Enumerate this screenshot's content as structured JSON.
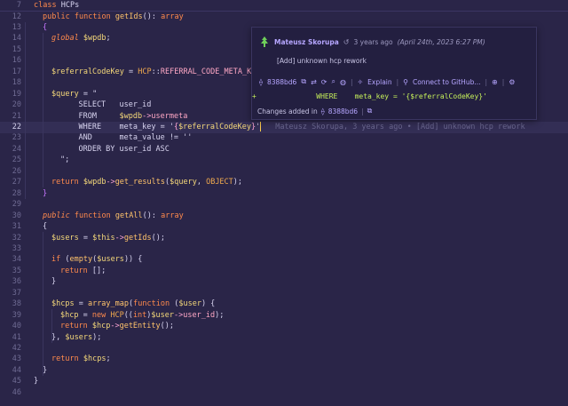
{
  "editor": {
    "sticky": {
      "number": "7",
      "kw": "class",
      "name": "HCPs"
    },
    "ghost_blame": "Mateusz Skorupa, 3 years ago • [Add] unknown hcp rework",
    "lines": [
      {
        "n": "12",
        "segs": [
          [
            "k",
            "public"
          ],
          [
            "c",
            " "
          ],
          [
            "k",
            "function"
          ],
          [
            "c",
            " "
          ],
          [
            "f",
            "getIds"
          ],
          [
            "c",
            "(): "
          ],
          [
            "k",
            "array"
          ]
        ]
      },
      {
        "n": "13",
        "segs": [
          [
            "bl",
            "{"
          ]
        ]
      },
      {
        "n": "14",
        "segs": [
          [
            "ki",
            "global"
          ],
          [
            "c",
            " "
          ],
          [
            "v",
            "$wpdb"
          ],
          [
            "c",
            ";"
          ]
        ]
      },
      {
        "n": "15",
        "segs": []
      },
      {
        "n": "16",
        "segs": []
      },
      {
        "n": "17",
        "segs": [
          [
            "v",
            "$referralCodeKey"
          ],
          [
            "c",
            " = "
          ],
          [
            "cls",
            "HCP"
          ],
          [
            "c",
            "::"
          ],
          [
            "s",
            "REFERRAL_CODE_META_KEY"
          ]
        ]
      },
      {
        "n": "18",
        "segs": []
      },
      {
        "n": "19",
        "segs": [
          [
            "v",
            "$query"
          ],
          [
            "c",
            " = \""
          ]
        ]
      },
      {
        "n": "20",
        "segs": [
          [
            "c",
            "    SELECT   user_id"
          ]
        ]
      },
      {
        "n": "21",
        "segs": [
          [
            "c",
            "    FROM     "
          ],
          [
            "v",
            "$wpdb"
          ],
          [
            "o",
            "->"
          ],
          [
            "s",
            "usermeta"
          ]
        ]
      },
      {
        "n": "22",
        "segs": [
          [
            "c",
            "    WHERE    meta_key = '"
          ],
          [
            "o",
            "{"
          ],
          [
            "v",
            "$referralCodeKey"
          ],
          [
            "o",
            "}"
          ],
          [
            "c",
            "'"
          ]
        ]
      },
      {
        "n": "23",
        "segs": [
          [
            "c",
            "    AND      meta_value != ''"
          ]
        ]
      },
      {
        "n": "24",
        "segs": [
          [
            "c",
            "    ORDER BY user_id ASC"
          ]
        ]
      },
      {
        "n": "25",
        "segs": [
          [
            "c",
            "\";"
          ]
        ]
      },
      {
        "n": "26",
        "segs": []
      },
      {
        "n": "27",
        "segs": [
          [
            "k",
            "return"
          ],
          [
            "c",
            " "
          ],
          [
            "v",
            "$wpdb"
          ],
          [
            "o",
            "->"
          ],
          [
            "f",
            "get_results"
          ],
          [
            "c",
            "("
          ],
          [
            "v",
            "$query"
          ],
          [
            "c",
            ", "
          ],
          [
            "cls",
            "OBJECT"
          ],
          [
            "c",
            ");"
          ]
        ]
      },
      {
        "n": "28",
        "segs": [
          [
            "bl",
            "}"
          ]
        ]
      },
      {
        "n": "29",
        "segs": []
      },
      {
        "n": "30",
        "segs": [
          [
            "ki",
            "public"
          ],
          [
            "c",
            " "
          ],
          [
            "k",
            "function"
          ],
          [
            "c",
            " "
          ],
          [
            "f",
            "getAll"
          ],
          [
            "c",
            "(): "
          ],
          [
            "k",
            "array"
          ]
        ]
      },
      {
        "n": "31",
        "segs": [
          [
            "c",
            "{"
          ]
        ]
      },
      {
        "n": "32",
        "segs": [
          [
            "v",
            "$users"
          ],
          [
            "c",
            " = "
          ],
          [
            "v",
            "$this"
          ],
          [
            "o",
            "->"
          ],
          [
            "f",
            "getIds"
          ],
          [
            "c",
            "();"
          ]
        ]
      },
      {
        "n": "33",
        "segs": []
      },
      {
        "n": "34",
        "segs": [
          [
            "k",
            "if"
          ],
          [
            "c",
            " ("
          ],
          [
            "f",
            "empty"
          ],
          [
            "c",
            "("
          ],
          [
            "v",
            "$users"
          ],
          [
            "c",
            ")) {"
          ]
        ]
      },
      {
        "n": "35",
        "segs": [
          [
            "k",
            "return"
          ],
          [
            "c",
            " [];"
          ]
        ]
      },
      {
        "n": "36",
        "segs": [
          [
            "c",
            "}"
          ]
        ]
      },
      {
        "n": "37",
        "segs": []
      },
      {
        "n": "38",
        "segs": [
          [
            "v",
            "$hcps"
          ],
          [
            "c",
            " = "
          ],
          [
            "f",
            "array_map"
          ],
          [
            "c",
            "("
          ],
          [
            "k",
            "function"
          ],
          [
            "c",
            " ("
          ],
          [
            "v",
            "$user"
          ],
          [
            "c",
            ") {"
          ]
        ]
      },
      {
        "n": "39",
        "segs": [
          [
            "v",
            "$hcp"
          ],
          [
            "c",
            " = "
          ],
          [
            "k",
            "new"
          ],
          [
            "c",
            " "
          ],
          [
            "cls",
            "HCP"
          ],
          [
            "c",
            "(("
          ],
          [
            "k",
            "int"
          ],
          [
            "c",
            ")"
          ],
          [
            "v",
            "$user"
          ],
          [
            "o",
            "->"
          ],
          [
            "s",
            "user_id"
          ],
          [
            "c",
            ");"
          ]
        ]
      },
      {
        "n": "40",
        "segs": [
          [
            "k",
            "return"
          ],
          [
            "c",
            " "
          ],
          [
            "v",
            "$hcp"
          ],
          [
            "o",
            "->"
          ],
          [
            "f",
            "getEntity"
          ],
          [
            "c",
            "();"
          ]
        ]
      },
      {
        "n": "41",
        "segs": [
          [
            "c",
            "}, "
          ],
          [
            "v",
            "$users"
          ],
          [
            "c",
            ");"
          ]
        ]
      },
      {
        "n": "42",
        "segs": []
      },
      {
        "n": "43",
        "segs": [
          [
            "k",
            "return"
          ],
          [
            "c",
            " "
          ],
          [
            "v",
            "$hcps"
          ],
          [
            "c",
            ";"
          ]
        ]
      },
      {
        "n": "44",
        "segs": [
          [
            "c",
            "}"
          ]
        ]
      },
      {
        "n": "45",
        "segs": [
          [
            "c",
            "}"
          ]
        ]
      },
      {
        "n": "46",
        "segs": []
      }
    ]
  },
  "hover": {
    "author": "Mateusz Skorupa",
    "relative_time": "3 years ago",
    "absolute_time": "(April 24th, 2023 6:27 PM)",
    "message": "[Add] unknown hcp rework",
    "commit": "8388bd6",
    "explain": "Explain",
    "connect": "Connect to GitHub...",
    "diff_line": "+              WHERE    meta_key = '{$referralCodeKey}'",
    "changes_label": "Changes added in",
    "changes_commit": "8388bd6"
  }
}
